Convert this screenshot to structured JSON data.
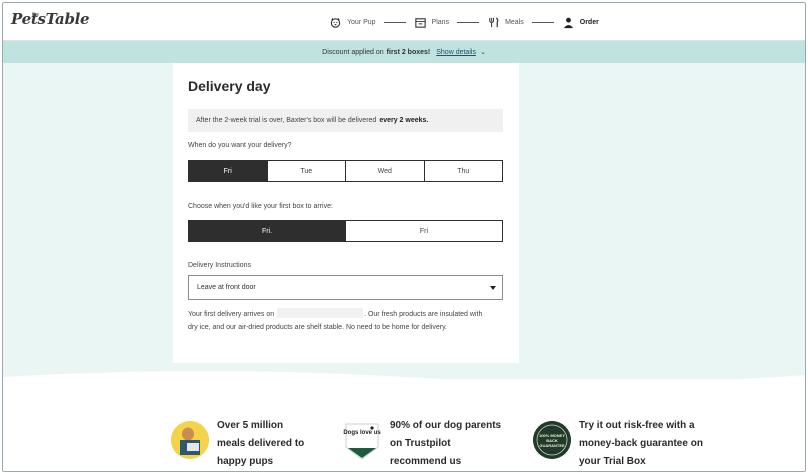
{
  "header": {
    "logo_small": "the",
    "logo": "PetsTable",
    "steps": [
      {
        "label": "Your Pup",
        "icon": "dog-face-icon"
      },
      {
        "label": "Plans",
        "icon": "calendar-icon"
      },
      {
        "label": "Meals",
        "icon": "fork-knife-icon"
      },
      {
        "label": "Order",
        "icon": "user-icon"
      }
    ]
  },
  "banner": {
    "text": "Discount applied on",
    "bold": "first 2 boxes!",
    "link": "Show details",
    "chevron": "⌄"
  },
  "delivery": {
    "title": "Delivery day",
    "notice_text": "After the 2-week trial is over, Baxter's box will be delivered",
    "notice_bold": "every 2 weeks.",
    "when_label": "When do you want your delivery?",
    "days": [
      "Fri",
      "Tue",
      "Wed",
      "Thu"
    ],
    "days_selected": 0,
    "first_box_label": "Choose when you'd like your first box to arrive:",
    "first_box_options": [
      "Fri.",
      "Fri"
    ],
    "first_box_selected": 0,
    "instructions_label": "Delivery Instructions",
    "instructions_value": "Leave at front door",
    "para_a": "Your first delivery arrives on",
    "para_b": ". Our fresh products are insulated with dry ice, and our air-dried products are shelf stable. No need to be home for delivery."
  },
  "features": [
    {
      "lines": [
        "Over 5 million",
        "meals delivered to",
        "happy pups"
      ],
      "badge_text": ""
    },
    {
      "lines": [
        "90% of our dog parents",
        "on Trustpilot",
        "recommend us"
      ],
      "badge_text": "Dogs love us"
    },
    {
      "lines": [
        "Try it out risk-free with a",
        "money-back guarantee on",
        "your Trial Box"
      ],
      "badge_text": "100% MONEY BACK GUARANTEE"
    }
  ],
  "colors": {
    "banner_bg": "#bfe3de",
    "page_bg": "#eaf6f3",
    "selected": "#2e2e2e"
  }
}
